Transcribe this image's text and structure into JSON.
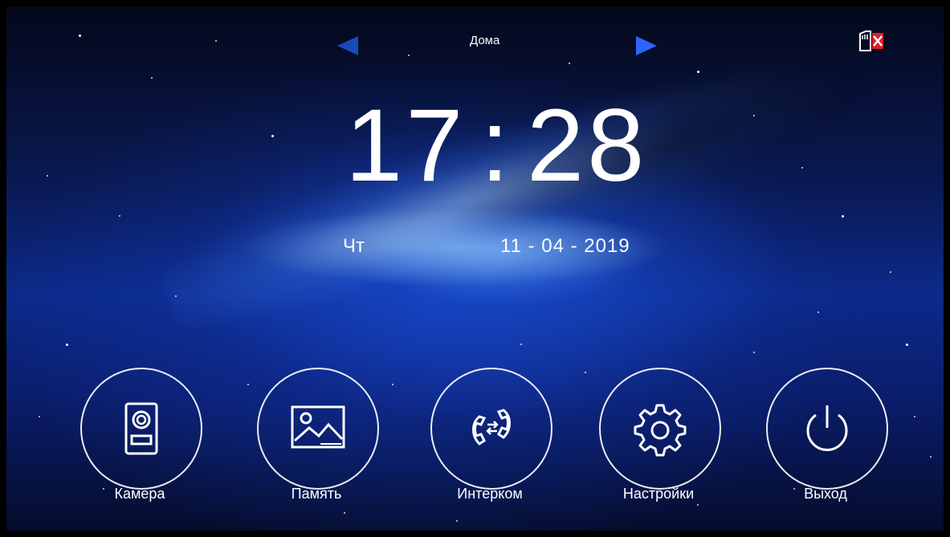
{
  "top_bar": {
    "location_label": "Дома",
    "prev_arrow": "left-arrow-icon",
    "next_arrow": "right-arrow-icon",
    "sd_icon": "sd-card-removed-icon"
  },
  "clock": {
    "hour": "17",
    "minute": "28",
    "separator": ":"
  },
  "date": {
    "weekday": "Чт",
    "date_text": "11 - 04 - 2019"
  },
  "menu": [
    {
      "label": "Камера",
      "icon": "door-camera-icon"
    },
    {
      "label": "Память",
      "icon": "image-memory-icon"
    },
    {
      "label": "Интерком",
      "icon": "intercom-handsets-icon"
    },
    {
      "label": "Настройки",
      "icon": "gear-icon"
    },
    {
      "label": "Выход",
      "icon": "power-icon"
    }
  ],
  "colors": {
    "background": "#0c2a8a",
    "accent_arrow": "#2f63ff",
    "sd_x": "#e01b24",
    "text": "#ffffff"
  }
}
